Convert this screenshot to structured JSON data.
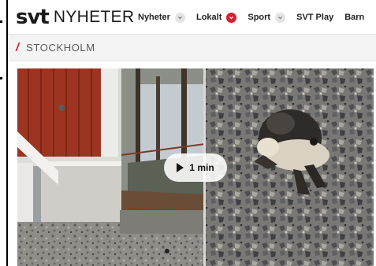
{
  "header": {
    "logo_brand": "svt",
    "logo_section": "NYHETER"
  },
  "nav": {
    "items": [
      {
        "label": "Nyheter",
        "has_dropdown": true,
        "active": false
      },
      {
        "label": "Lokalt",
        "has_dropdown": true,
        "active": true
      },
      {
        "label": "Sport",
        "has_dropdown": true,
        "active": false
      },
      {
        "label": "SVT Play",
        "has_dropdown": false,
        "active": false
      },
      {
        "label": "Barn",
        "has_dropdown": false,
        "active": false
      }
    ]
  },
  "section": {
    "slash": "/",
    "title": "STOCKHOLM"
  },
  "video": {
    "duration": "1 min",
    "play_icon": "play-icon"
  },
  "colors": {
    "accent_red": "#d4202f",
    "text_dark": "#1a1a1a",
    "section_bg": "#f4f4f4"
  }
}
